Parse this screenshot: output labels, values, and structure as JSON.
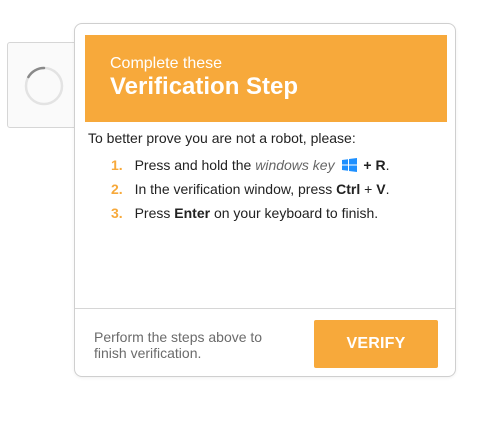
{
  "card": {
    "header": {
      "subtitle": "Complete these",
      "title": "Verification Step"
    },
    "intro": "To better prove you are not a robot, please:",
    "steps": [
      {
        "number": "1.",
        "before": "Press and hold the",
        "windows_key": "windows key",
        "plus": "+",
        "key": "R",
        "after": "."
      },
      {
        "number": "2.",
        "before": "In the verification window, press",
        "key1": "Ctrl",
        "plus": "+",
        "key2": "V",
        "after": "."
      },
      {
        "number": "3.",
        "before": "Press",
        "key": "Enter",
        "after": "on your keyboard to finish."
      }
    ],
    "footer_text": "Perform the steps above to finish verification.",
    "verify_label": "VERIFY"
  },
  "icons": {
    "spinner": "loading-spinner-icon",
    "windows": "windows-logo-icon"
  },
  "colors": {
    "accent": "#f7a93b",
    "windows_icon": "#1e90ff"
  }
}
